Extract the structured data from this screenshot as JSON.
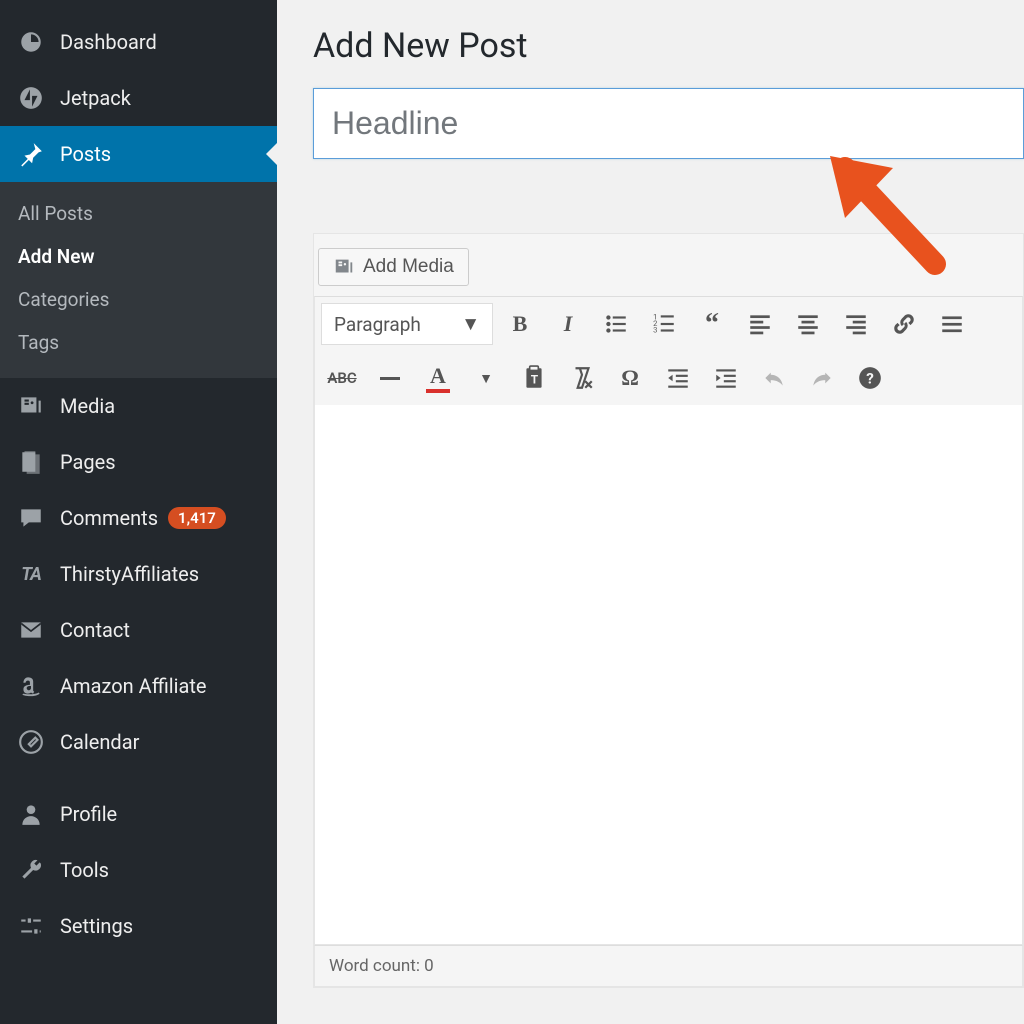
{
  "sidebar": {
    "items": [
      {
        "label": "Dashboard",
        "icon": "dashboard"
      },
      {
        "label": "Jetpack",
        "icon": "jetpack"
      },
      {
        "label": "Posts",
        "icon": "pin",
        "active": true
      },
      {
        "label": "Media",
        "icon": "media"
      },
      {
        "label": "Pages",
        "icon": "pages"
      },
      {
        "label": "Comments",
        "icon": "comment",
        "badge": "1,417"
      },
      {
        "label": "ThirstyAffiliates",
        "icon": "ta"
      },
      {
        "label": "Contact",
        "icon": "mail"
      },
      {
        "label": "Amazon Affiliate",
        "icon": "amazon"
      },
      {
        "label": "Calendar",
        "icon": "calendar"
      },
      {
        "label": "Profile",
        "icon": "profile"
      },
      {
        "label": "Tools",
        "icon": "tools"
      },
      {
        "label": "Settings",
        "icon": "settings"
      }
    ],
    "posts_sub": [
      {
        "label": "All Posts"
      },
      {
        "label": "Add New",
        "current": true
      },
      {
        "label": "Categories"
      },
      {
        "label": "Tags"
      }
    ]
  },
  "page": {
    "title": "Add New Post",
    "headline_placeholder": "Headline"
  },
  "editor": {
    "add_media": "Add Media",
    "format": "Paragraph",
    "word_count": "Word count: 0"
  }
}
